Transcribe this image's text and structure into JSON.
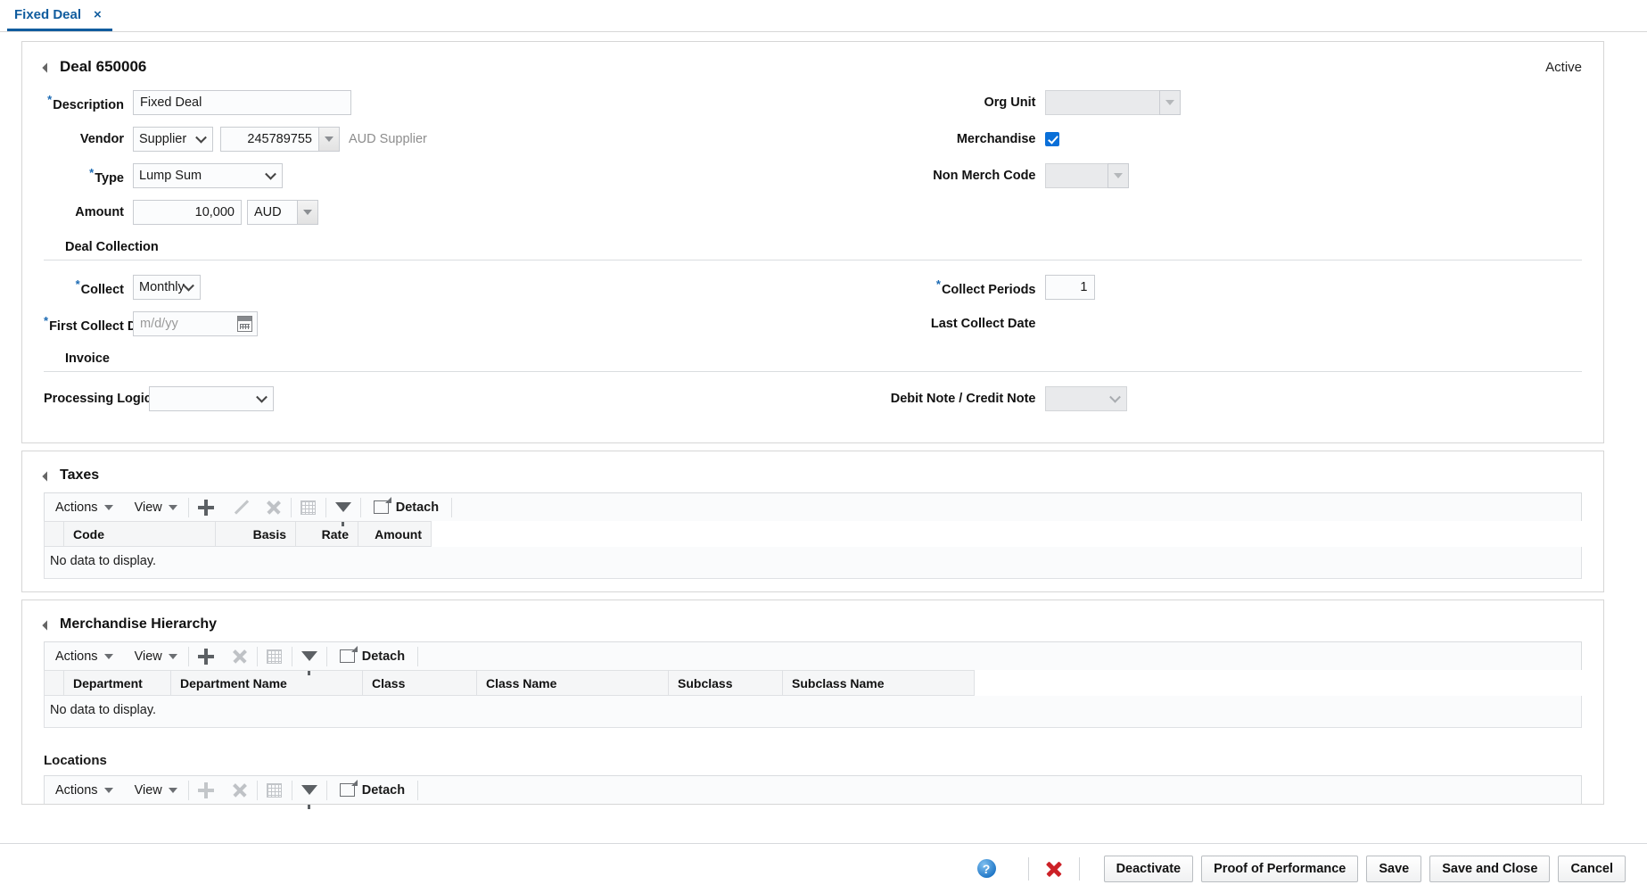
{
  "tab": {
    "label": "Fixed Deal",
    "close": "×"
  },
  "deal": {
    "title": "Deal 650006",
    "status": "Active",
    "fields": {
      "description_label": "Description",
      "description_value": "Fixed Deal",
      "vendor_label": "Vendor",
      "vendor_type_value": "Supplier",
      "vendor_type_options": [
        "Supplier"
      ],
      "vendor_id_value": "245789755",
      "vendor_name": "AUD Supplier",
      "type_label": "Type",
      "type_value": "Lump Sum",
      "type_options": [
        "Lump Sum"
      ],
      "amount_label": "Amount",
      "amount_value": "10,000",
      "currency_value": "AUD",
      "org_unit_label": "Org Unit",
      "org_unit_value": "",
      "merchandise_label": "Merchandise",
      "merchandise_checked": true,
      "non_merch_code_label": "Non Merch Code",
      "non_merch_code_value": ""
    },
    "deal_collection": {
      "heading": "Deal Collection",
      "collect_label": "Collect",
      "collect_value": "Monthly",
      "collect_options": [
        "Monthly"
      ],
      "first_collect_date_label": "First Collect Date",
      "first_collect_date_value": "",
      "first_collect_date_placeholder": "m/d/yy",
      "collect_periods_label": "Collect Periods",
      "collect_periods_value": "1",
      "last_collect_date_label": "Last Collect Date",
      "last_collect_date_value": ""
    },
    "invoice": {
      "heading": "Invoice",
      "processing_logic_label": "Processing Logic",
      "processing_logic_value": "",
      "debit_credit_label": "Debit Note / Credit Note",
      "debit_credit_value": ""
    }
  },
  "toolbar_labels": {
    "actions": "Actions",
    "view": "View",
    "detach": "Detach"
  },
  "taxes": {
    "title": "Taxes",
    "columns": [
      "Code",
      "Basis",
      "Rate",
      "Amount"
    ],
    "rows": [],
    "no_data": "No data to display."
  },
  "merchandise_hierarchy": {
    "title": "Merchandise Hierarchy",
    "columns": [
      "Department",
      "Department Name",
      "Class",
      "Class Name",
      "Subclass",
      "Subclass Name"
    ],
    "rows": [],
    "no_data": "No data to display."
  },
  "locations": {
    "title": "Locations"
  },
  "footer": {
    "help": "?",
    "buttons": [
      "Deactivate",
      "Proof of Performance",
      "Save",
      "Save and Close",
      "Cancel"
    ]
  },
  "colors": {
    "accent": "#105c9e",
    "required": "#1b6ab3",
    "checkbox": "#0a6fd8",
    "delete": "#cc2127"
  }
}
